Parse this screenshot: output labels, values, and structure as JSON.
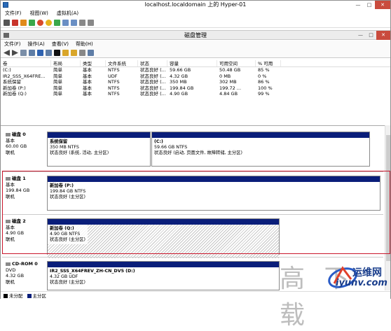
{
  "vm": {
    "title": "localhost.localdomain 上的 Hyper-01",
    "menu": [
      "文件(F)",
      "视图(W)",
      "虚拟机(A)"
    ]
  },
  "dm": {
    "title": "磁盘管理",
    "menu": [
      "文件(F)",
      "操作(A)",
      "查看(V)",
      "帮助(H)"
    ]
  },
  "volumes": {
    "headers": [
      "卷",
      "布局",
      "类型",
      "文件系统",
      "状态",
      "容量",
      "可用空间",
      "% 可用"
    ],
    "rows": [
      [
        "(C:)",
        "简单",
        "基本",
        "NTFS",
        "状态良好 (...",
        "59.66 GB",
        "50.48 GB",
        "85 %"
      ],
      [
        "IR2_SSS_X64FRE...",
        "简单",
        "基本",
        "UDF",
        "状态良好 (...",
        "4.32 GB",
        "0 MB",
        "0 %"
      ],
      [
        "系统保留",
        "简单",
        "基本",
        "NTFS",
        "状态良好 (...",
        "350 MB",
        "302 MB",
        "86 %"
      ],
      [
        "新加卷 (P:)",
        "简单",
        "基本",
        "NTFS",
        "状态良好 (...",
        "199.84 GB",
        "199.72 ...",
        "100 %"
      ],
      [
        "新加卷 (Q:)",
        "简单",
        "基本",
        "NTFS",
        "状态良好 (...",
        "4.90 GB",
        "4.84 GB",
        "99 %"
      ]
    ]
  },
  "disks": {
    "disk0": {
      "name": "磁盘 0",
      "type": "基本",
      "size": "60.00 GB",
      "status": "联机",
      "p1": {
        "name": "系统保留",
        "size": "350 MB NTFS",
        "status": "状态良好 (系统, 活动, 主分区)"
      },
      "p2": {
        "name": "(C:)",
        "size": "59.66 GB NTFS",
        "status": "状态良好 (启动, 页面文件, 故障转储, 主分区)"
      }
    },
    "disk1": {
      "name": "磁盘 1",
      "type": "基本",
      "size": "199.84 GB",
      "status": "联机",
      "p1": {
        "name": "新加卷 (P:)",
        "size": "199.84 GB NTFS",
        "status": "状态良好 (主分区)"
      }
    },
    "disk2": {
      "name": "磁盘 2",
      "type": "基本",
      "size": "4.90 GB",
      "status": "联机",
      "p1": {
        "name": "新加卷 (Q:)",
        "size": "4.90 GB NTFS",
        "status": "状态良好 (主分区)"
      }
    },
    "cdrom0": {
      "name": "CD-ROM 0",
      "type": "DVD",
      "size": "4.32 GB",
      "status": "联机",
      "p1": {
        "name": "IR2_SSS_X64FREV_ZH-CN_DV5 (D:)",
        "size": "4.32 GB UDF",
        "status": "状态良好 (主分区)"
      }
    }
  },
  "legend": [
    "未分配",
    "主分区"
  ],
  "watermark": {
    "cjk": "高 下 载",
    "site": "运维网",
    "url": "iyunv.com"
  },
  "colors": {
    "partition_bar": "#0a1e7a",
    "highlight": "#c9162b"
  }
}
